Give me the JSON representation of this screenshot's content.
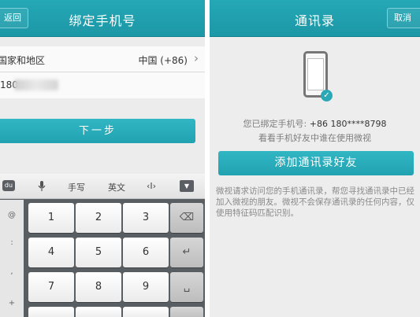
{
  "left": {
    "title": "绑定手机号",
    "back_label": "返回",
    "country_label": "国家和地区",
    "country_value": "中国 (+86)",
    "phone_value": "180",
    "next_label": "下一步",
    "keyboard": {
      "tools": [
        "手写",
        "英文"
      ],
      "side_keys": [
        "@",
        ":",
        ",",
        "+"
      ],
      "keys": [
        "1",
        "2",
        "3",
        "4",
        "5",
        "6",
        "7",
        "8",
        "9"
      ]
    }
  },
  "right": {
    "title": "通讯录",
    "cancel_label": "取消",
    "bound_prefix": "您已绑定手机号:",
    "bound_number": "+86 180****8798",
    "subtitle": "看看手机好友中谁在使用微视",
    "add_label": "添加通讯录好友",
    "description": "微视请求访问您的手机通讯录，帮您寻找通讯录中已经加入微视的朋友。微视不会保存通讯录的任何内容，仅使用特征码匹配识别。"
  },
  "colors": {
    "accent": "#22a2b1",
    "title_bar": "#1f9dac"
  }
}
